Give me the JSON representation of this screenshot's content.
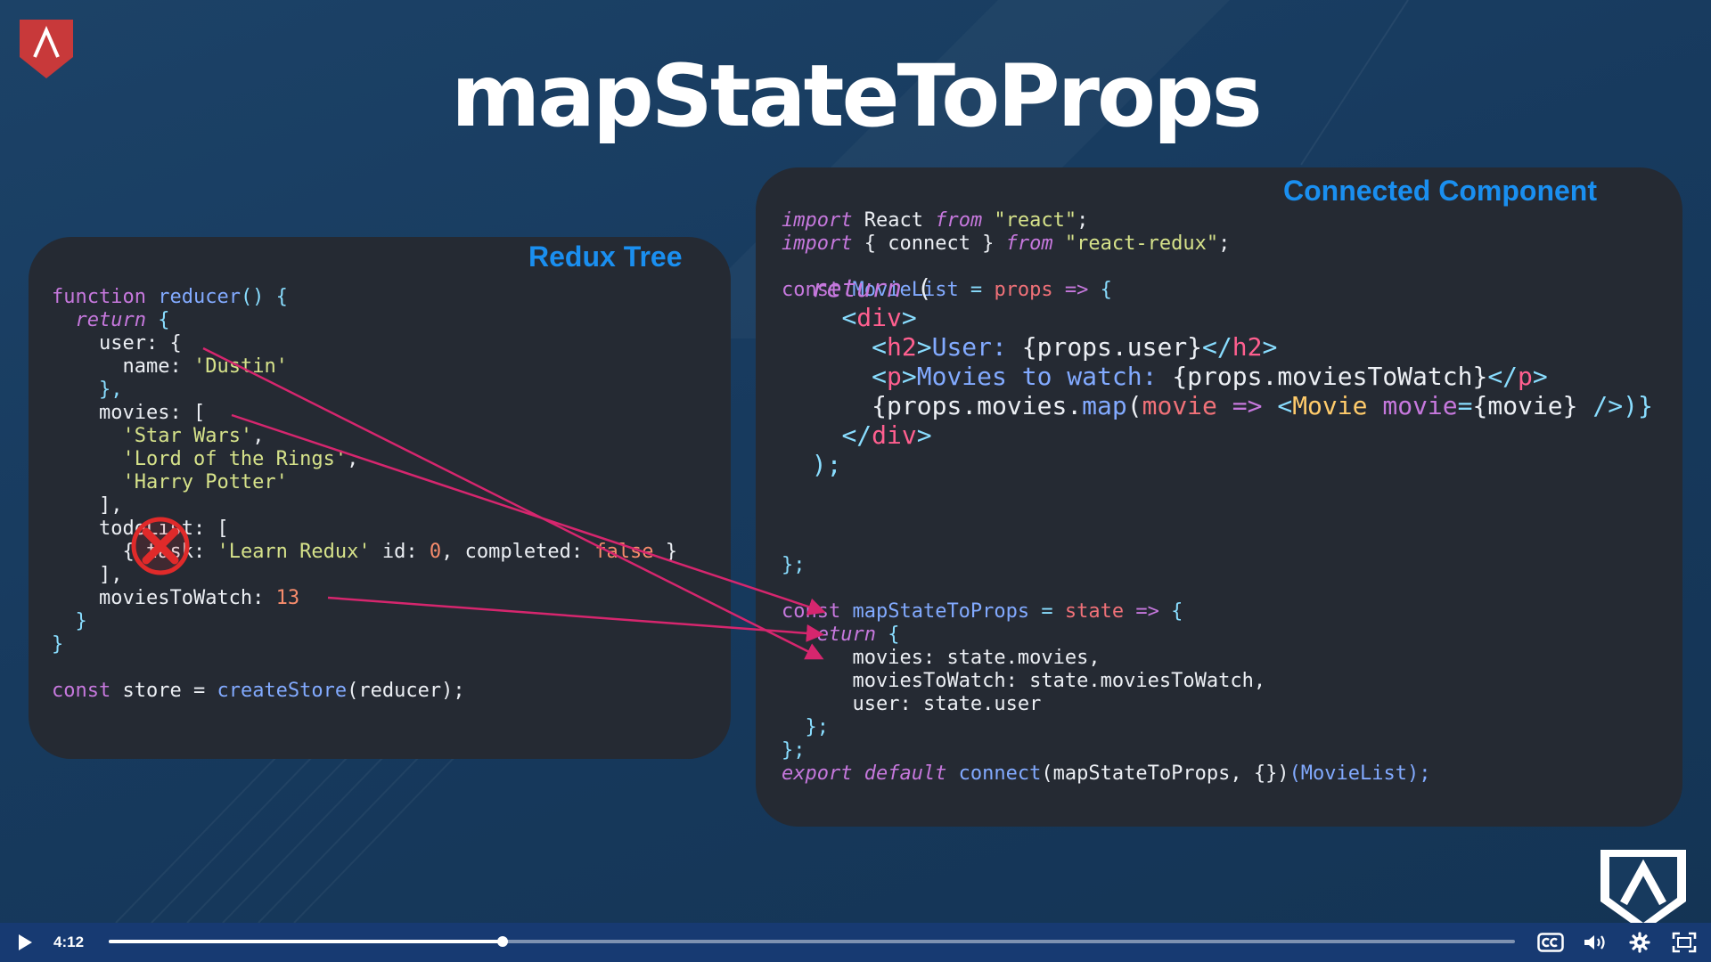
{
  "slide": {
    "title": "mapStateToProps",
    "left_panel": {
      "title": "Redux Tree",
      "code": {
        "l1_kw": "function",
        "l1_fn": "reducer",
        "l1_rest": "() {",
        "l2_kw": "return",
        "l2_rest": " {",
        "l3": "user: {",
        "l4_key": "name: ",
        "l4_val": "'Dustin'",
        "l5": "},",
        "l6": "movies: [",
        "l7": "'Star Wars'",
        "l7_sep": ",",
        "l8": "'Lord of the Rings'",
        "l8_sep": ",",
        "l9": "'Harry Potter'",
        "l10": "],",
        "l11": "todoList: [",
        "l12_a": "{ task: ",
        "l12_str": "'Learn Redux'",
        "l12_b": " id: ",
        "l12_num": "0",
        "l12_c": ", completed: ",
        "l12_false": "false",
        "l12_d": " }",
        "l13": "],",
        "l14_key": "moviesToWatch: ",
        "l14_num": "13",
        "l15": "}",
        "l16": "}",
        "l17_kw": "const",
        "l17_a": " store = ",
        "l17_fn": "createStore",
        "l17_b": "(reducer);"
      }
    },
    "right_panel": {
      "title": "Connected Component",
      "code": {
        "i1_kw": "import",
        "i1_a": " React ",
        "i1_from": "from",
        "i1_str": " \"react\"",
        "i1_end": ";",
        "i2_kw": "import",
        "i2_a": " { connect } ",
        "i2_from": "from",
        "i2_str": " \"react-redux\"",
        "i2_end": ";",
        "c1_kw": "const",
        "c1_name": " MovieList",
        "c1_eq": " = ",
        "c1_param": "props",
        "c1_arrow": " => ",
        "c1_brace": "{",
        "r1_kw": "return",
        "r1_paren": " (",
        "r2_open": "<",
        "r2_tag": "div",
        "r2_close": ">",
        "r3_open": "<",
        "r3_tag": "h2",
        "r3_close": ">",
        "r3_text": "User: ",
        "r3_expr": "{props.user}",
        "r3_end_open": "</",
        "r3_end_tag": "h2",
        "r3_end_close": ">",
        "r4_open": "<",
        "r4_tag": "p",
        "r4_close": ">",
        "r4_text": "Movies to watch: ",
        "r4_expr": "{props.moviesToWatch}",
        "r4_end_open": "</",
        "r4_end_tag": "p",
        "r4_end_close": ">",
        "r5_a": "{props.movies.",
        "r5_map": "map",
        "r5_paren": "(",
        "r5_param": "movie",
        "r5_arrow": " => ",
        "r5_lt": "<",
        "r5_comp": "Movie",
        "r5_attr": " movie",
        "r5_eq": "=",
        "r5_expr": "{movie}",
        "r5_end": " />)}",
        "r6_open": "</",
        "r6_tag": "div",
        "r6_close": ">",
        "r7": ");",
        "r8": "};",
        "m1_kw": "const",
        "m1_name": " mapStateToProps",
        "m1_eq": " = ",
        "m1_param": "state",
        "m1_arrow": " => ",
        "m1_brace": "{",
        "m2_kw": "return",
        "m2_brace": " {",
        "m3": "movies: state.movies,",
        "m4": "moviesToWatch: state.moviesToWatch,",
        "m5": "user: state.user",
        "m6": "};",
        "m7": "};",
        "e1_kw": "export default",
        "e1_fn": " connect",
        "e1_a": "(mapStateToProps, {})",
        "e1_b": "(MovieList);"
      }
    }
  },
  "player": {
    "time": "4:12",
    "progress_fraction": 0.28,
    "icons": [
      "play-icon",
      "closed-captions-icon",
      "volume-icon",
      "settings-gear-icon",
      "fullscreen-icon"
    ]
  },
  "colors": {
    "arrow": "#d6266e",
    "accent_blue": "#1a8ff0",
    "player_bar": "#173a72"
  }
}
